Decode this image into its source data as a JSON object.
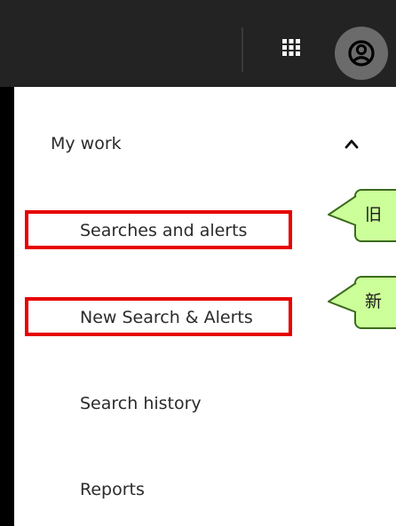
{
  "header": {
    "apps_icon": "grid-icon",
    "account_icon": "user-circle-icon"
  },
  "menu": {
    "section_title": "My work",
    "section_state_icon": "chevron-up-icon",
    "items": [
      {
        "label": "Searches and alerts",
        "highlighted": true
      },
      {
        "label": "New Search & Alerts",
        "highlighted": true
      },
      {
        "label": "Search history",
        "highlighted": false
      },
      {
        "label": "Reports",
        "highlighted": false
      }
    ]
  },
  "annotations": {
    "callouts": [
      {
        "text": "旧",
        "points_to": "Searches and alerts"
      },
      {
        "text": "新",
        "points_to": "New Search & Alerts"
      }
    ]
  },
  "colors": {
    "header_bg": "#232323",
    "highlight_border": "#e60000",
    "callout_fill": "#ccff99",
    "callout_border": "#3a6b1c",
    "avatar_bg": "#6b6b6b"
  }
}
